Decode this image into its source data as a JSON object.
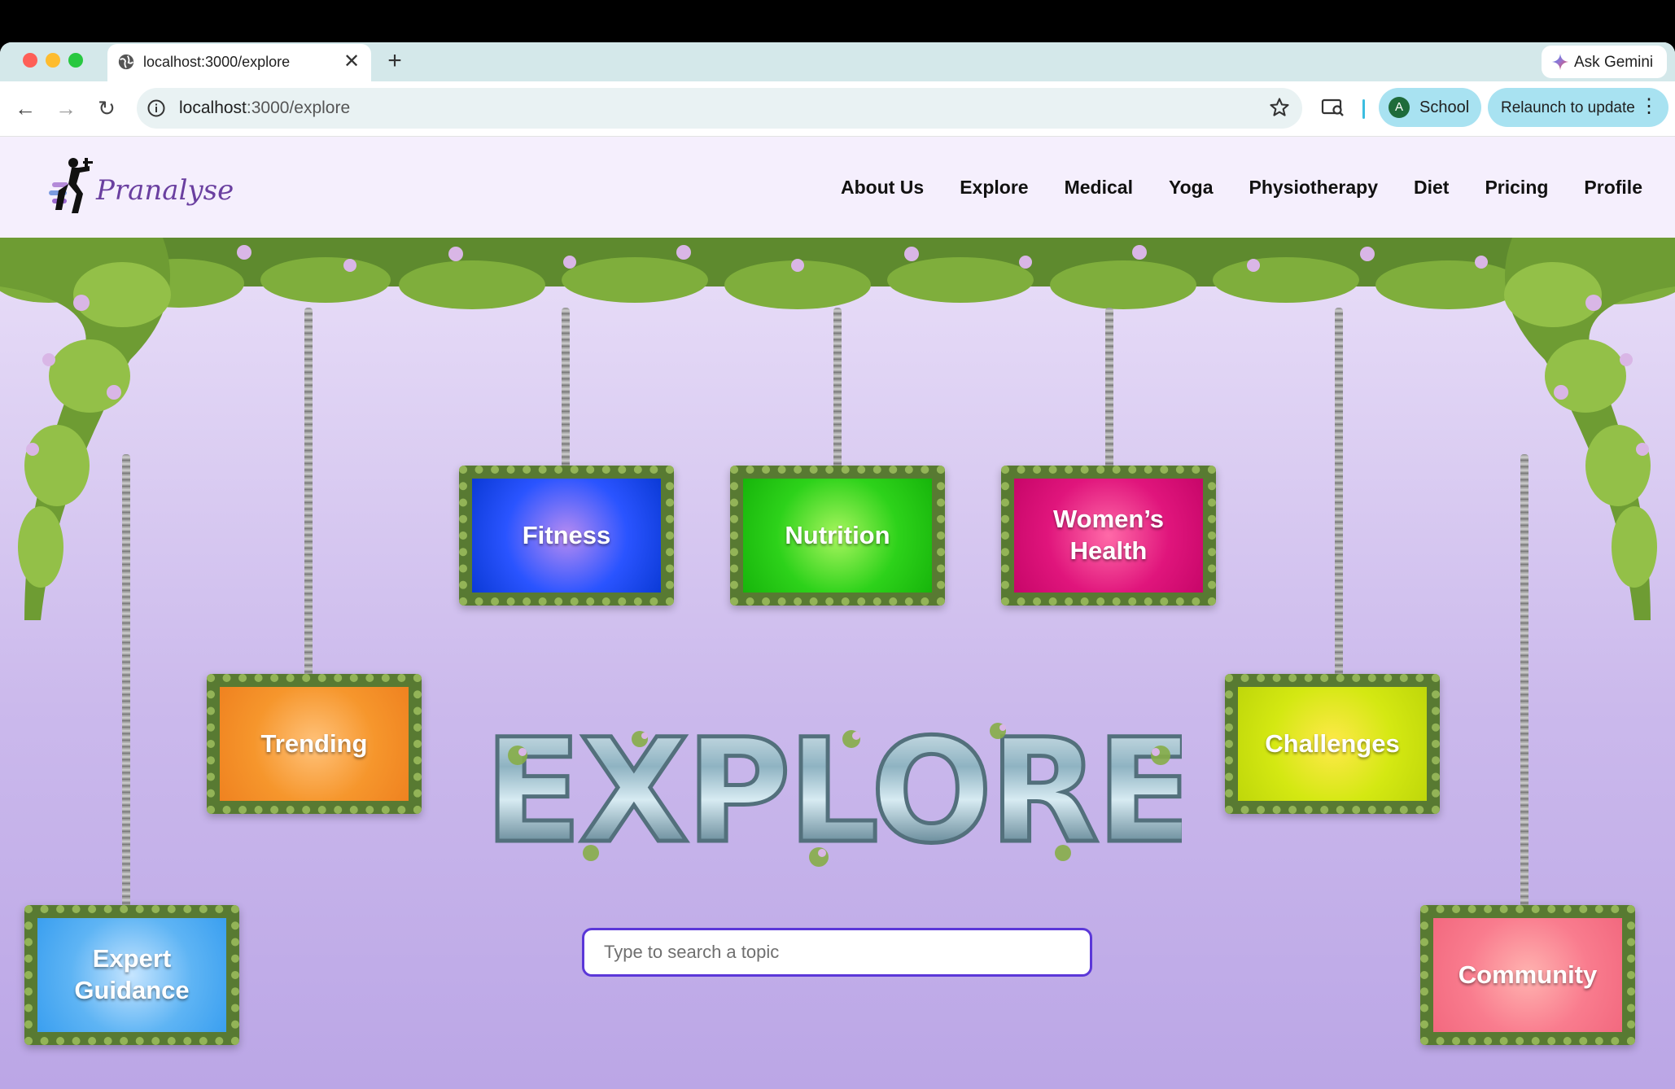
{
  "browser": {
    "tab_title": "localhost:3000/explore",
    "tab_close": "✕",
    "new_tab": "+",
    "gemini_label": "Ask Gemini",
    "url_host": "localhost",
    "url_path": ":3000/explore",
    "profile_initial": "A",
    "profile_label": "School",
    "relaunch_label": "Relaunch to update",
    "back": "←",
    "forward": "→",
    "reload": "↻",
    "menu": "⋮"
  },
  "site": {
    "logo_text": "Pranalyse",
    "nav": [
      "About Us",
      "Explore",
      "Medical",
      "Yoga",
      "Physiotherapy",
      "Diet",
      "Pricing",
      "Profile"
    ]
  },
  "signs": {
    "fitness": "Fitness",
    "nutrition": "Nutrition",
    "womens_health_line1": "Women’s",
    "womens_health_line2": "Health",
    "trending": "Trending",
    "challenges": "Challenges",
    "expert_line1": "Expert",
    "expert_line2": "Guidance",
    "community": "Community"
  },
  "hero_title": "EXPLORE",
  "search": {
    "placeholder": "Type to search a topic",
    "value": ""
  },
  "colors": {
    "accent": "#5b37d8",
    "fitness": "#2a54ff",
    "nutrition": "#2dd21a",
    "womens_health": "#e0157c",
    "trending": "#f6962c",
    "challenges": "#d4e812",
    "expert_guidance": "#5eb4f4",
    "community": "#f97c8e"
  }
}
